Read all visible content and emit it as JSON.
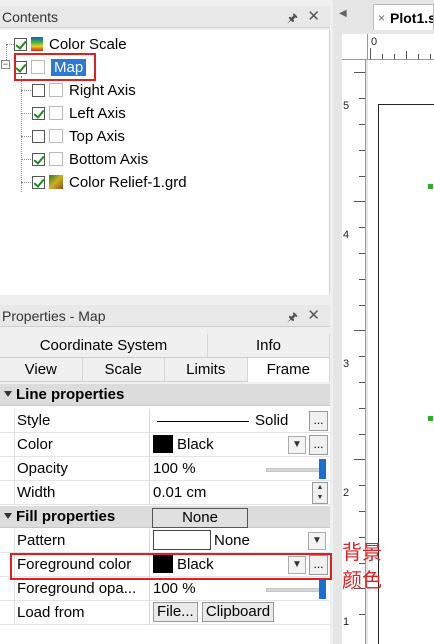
{
  "contents": {
    "title": "Contents",
    "pin_icon": "pin-icon",
    "close_icon": "close-icon",
    "tree": [
      {
        "label": "Color Scale",
        "checked": true,
        "icon": "color-scale-icon"
      },
      {
        "label": "Map",
        "checked": true,
        "icon": "map-icon",
        "selected": true
      },
      {
        "label": "Right Axis",
        "checked": false,
        "icon": "axis-icon"
      },
      {
        "label": "Left Axis",
        "checked": true,
        "icon": "axis-icon"
      },
      {
        "label": "Top Axis",
        "checked": false,
        "icon": "axis-icon"
      },
      {
        "label": "Bottom Axis",
        "checked": true,
        "icon": "axis-icon"
      },
      {
        "label": "Color Relief-1.grd",
        "checked": true,
        "icon": "color-relief-icon"
      }
    ]
  },
  "properties": {
    "title": "Properties - Map",
    "tabs_row1": [
      "Coordinate System",
      "Info"
    ],
    "tabs_row2": [
      "View",
      "Scale",
      "Limits",
      "Frame"
    ],
    "active_tab": "Frame",
    "line_section": "Line properties",
    "fill_section": "Fill properties",
    "rows": {
      "style": {
        "name": "Style",
        "value": "Solid"
      },
      "color": {
        "name": "Color",
        "value": "Black",
        "swatch": "#000000"
      },
      "opacity": {
        "name": "Opacity",
        "value": "100 %"
      },
      "width": {
        "name": "Width",
        "value": "0.01 cm"
      },
      "fill_header_value": "None",
      "pattern": {
        "name": "Pattern",
        "value": "None"
      },
      "fg_color": {
        "name": "Foreground color",
        "value": "Black",
        "swatch": "#000000"
      },
      "fg_opacity": {
        "name": "Foreground opa...",
        "value": "100 %"
      },
      "load_from": {
        "name": "Load from",
        "file_button": "File...",
        "clipboard_button": "Clipboard"
      }
    }
  },
  "plot": {
    "tab_label": "Plot1.s",
    "ruler_top": [
      "0"
    ],
    "ruler_left": [
      "5",
      "4",
      "3",
      "2",
      "1"
    ]
  },
  "annotation": {
    "line1": "背景",
    "line2": "颜色",
    "color": "#e02020"
  },
  "colors": {
    "selection": "#2a78d8",
    "highlight_box": "#e02020",
    "slider": "#1a6ed8",
    "handle": "#2ab02a"
  }
}
